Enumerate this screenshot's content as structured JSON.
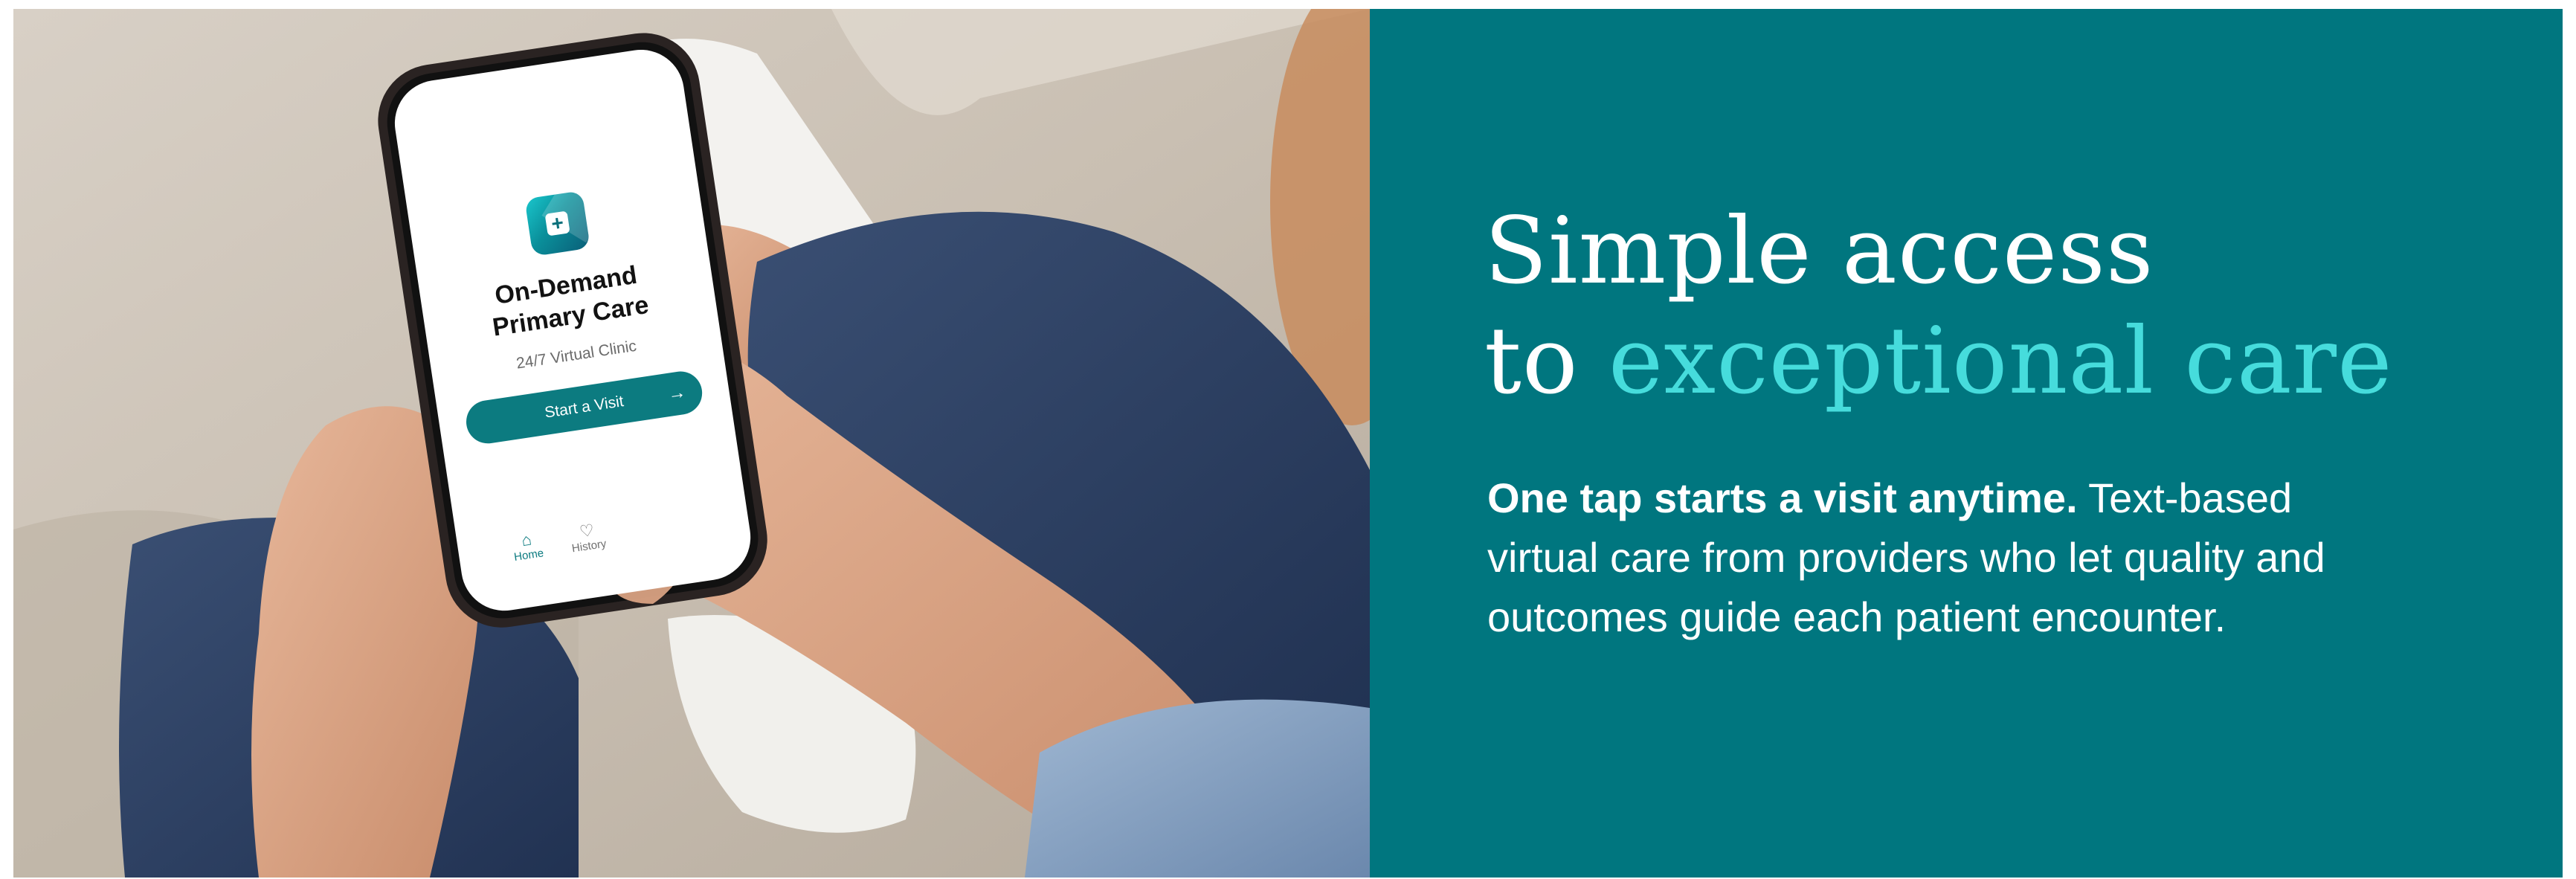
{
  "headline": {
    "line1": "Simple access",
    "line2_prefix": "to ",
    "line2_accent": "exceptional care"
  },
  "body": {
    "lead": "One tap starts a visit anytime.",
    "text": " Text-based virtual care from providers who let quality and outcomes guide each patient encounter."
  },
  "phone_app": {
    "title_line1": "On-Demand",
    "title_line2": "Primary Care",
    "subtitle": "24/7 Virtual Clinic",
    "cta_label": "Start a Visit",
    "cta_arrow": "→",
    "nav": {
      "home_label": "Home",
      "home_icon": "⌂",
      "history_label": "History",
      "history_icon": "♡"
    }
  },
  "colors": {
    "panel": "#00767f",
    "accent_text": "#46dcdc",
    "button": "#0c7b80"
  }
}
